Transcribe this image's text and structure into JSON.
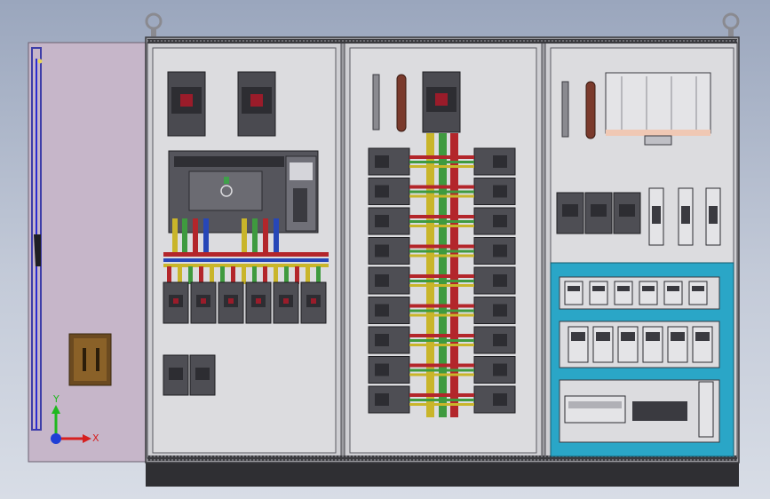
{
  "view": {
    "axis_x_label": "X",
    "axis_y_label": "Y"
  },
  "cabinet": {
    "sections": [
      "left-section",
      "middle-section",
      "right-section"
    ],
    "breaker_rows_middle": 9
  },
  "colors": {
    "background_top": "#9aa6bd",
    "background_bottom": "#d8dde6",
    "panel_fill": "#d9d9dc",
    "door_fill": "#c9b8cc",
    "plinth": "#2f2f33",
    "cyan_frame": "#2aa6c7",
    "bus_red": "#b3262b",
    "bus_yellow": "#c9b52a",
    "bus_green": "#3f9a3f",
    "bus_blue": "#2747b8",
    "axis_x": "#d62020",
    "axis_y": "#1fb81f",
    "axis_z": "#1f3fd6"
  },
  "icons": [
    "lifting-eye-icon",
    "coordinate-triad-icon",
    "door-handle-icon"
  ]
}
